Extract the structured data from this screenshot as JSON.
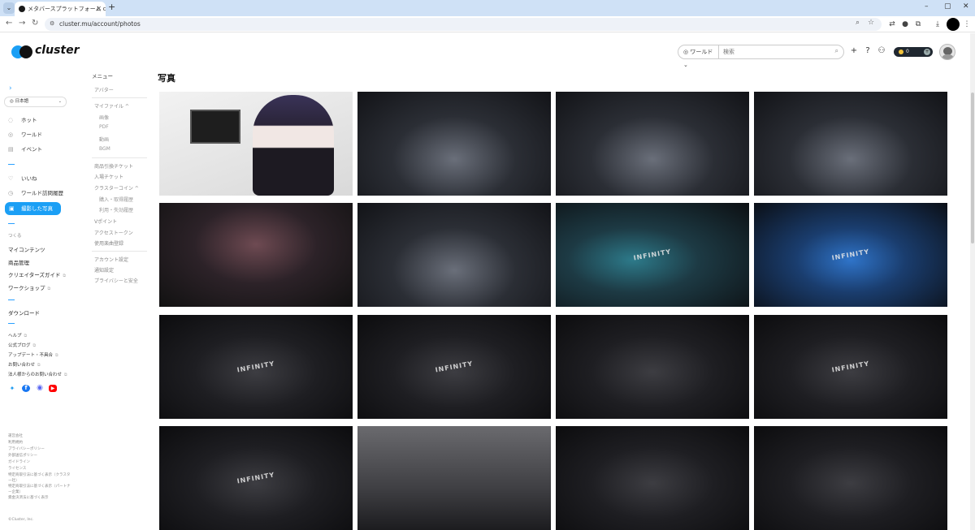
{
  "browser": {
    "tab_title": "メタバースプラットフォーム cluster",
    "url": "cluster.mu/account/photos",
    "window_controls": [
      "–",
      "▢",
      "✕"
    ]
  },
  "header": {
    "logo_text": "cluster",
    "world_select": "ワールド",
    "search_placeholder": "検索",
    "coin_value": "0"
  },
  "sidebar": {
    "language": "日本語",
    "primary": [
      {
        "icon": "fire-icon",
        "glyph": "◌",
        "label": "ホット"
      },
      {
        "icon": "world-icon",
        "glyph": "◎",
        "label": "ワールド"
      },
      {
        "icon": "calendar-icon",
        "glyph": "▤",
        "label": "イベント"
      }
    ],
    "secondary": [
      {
        "icon": "heart-icon",
        "glyph": "♡",
        "label": "いいね"
      },
      {
        "icon": "history-icon",
        "glyph": "◷",
        "label": "ワールド訪問履歴"
      },
      {
        "icon": "photo-icon",
        "glyph": "▣",
        "label": "撮影した写真",
        "active": true
      }
    ],
    "create_label": "つくる",
    "create_links": [
      "マイコンテンツ",
      "商品管理",
      "クリエイターズガイド",
      "ワークショップ"
    ],
    "download": "ダウンロード",
    "help_links": [
      "ヘルプ",
      "公式ブログ",
      "アップデート・不具合",
      "お問い合わせ",
      "法人様からのお問い合わせ"
    ],
    "footer_links": [
      "運営会社",
      "利用規約",
      "プライバシーポリシー",
      "外部送信ポリシー",
      "ガイドライン",
      "ライセンス",
      "特定商取引法に基づく表示（クラスター社）",
      "特定商取引法に基づく表示（パートナー企業）",
      "資金決済法に基づく表示"
    ],
    "copyright": "©Cluster, Inc."
  },
  "menu": {
    "title": "メニュー",
    "items": [
      {
        "label": "アバター",
        "level": 0
      },
      {
        "label": "マイファイル ^",
        "level": 0
      },
      {
        "label": "画像",
        "level": 1
      },
      {
        "label": "PDF",
        "level": 1
      },
      {
        "label": "動画",
        "level": 1
      },
      {
        "label": "BGM",
        "level": 1
      },
      {
        "label": "商品引換チケット",
        "level": 0
      },
      {
        "label": "入場チケット",
        "level": 0
      },
      {
        "label": "クラスターコイン ^",
        "level": 0
      },
      {
        "label": "購入・取得履歴",
        "level": 1
      },
      {
        "label": "利用・失効履歴",
        "level": 1
      },
      {
        "label": "Vポイント",
        "level": 0
      },
      {
        "label": "アクセストークン",
        "level": 0
      },
      {
        "label": "使用楽曲登録",
        "level": 0
      },
      {
        "label": "アカウント設定",
        "level": 0
      },
      {
        "label": "通知設定",
        "level": 0
      },
      {
        "label": "プライバシーと安全",
        "level": 0
      }
    ]
  },
  "main": {
    "title": "写真",
    "photos": [
      {
        "label": "",
        "scene": "room"
      },
      {
        "label": "",
        "scene": "stage"
      },
      {
        "label": "",
        "scene": "stage"
      },
      {
        "label": "",
        "scene": "stage"
      },
      {
        "label": "",
        "scene": "stage-red"
      },
      {
        "label": "",
        "scene": "stage"
      },
      {
        "label": "INFINITY",
        "scene": "cyan"
      },
      {
        "label": "INFINITY",
        "scene": "blue"
      },
      {
        "label": "INFINITY",
        "scene": "dark"
      },
      {
        "label": "INFINITY",
        "scene": "dark"
      },
      {
        "label": "",
        "scene": "dark"
      },
      {
        "label": "INFINITY",
        "scene": "dark"
      },
      {
        "label": "INFINITY",
        "scene": "dark"
      },
      {
        "label": "",
        "scene": "grey"
      },
      {
        "label": "",
        "scene": "dark"
      },
      {
        "label": "",
        "scene": "dark"
      }
    ]
  },
  "colors": {
    "accent": "#1b9ff5",
    "coin": "#f0c23c",
    "twitter": "#1d9bf0",
    "facebook": "#1877f2",
    "discord": "#5865f2",
    "youtube": "#ff0000"
  }
}
